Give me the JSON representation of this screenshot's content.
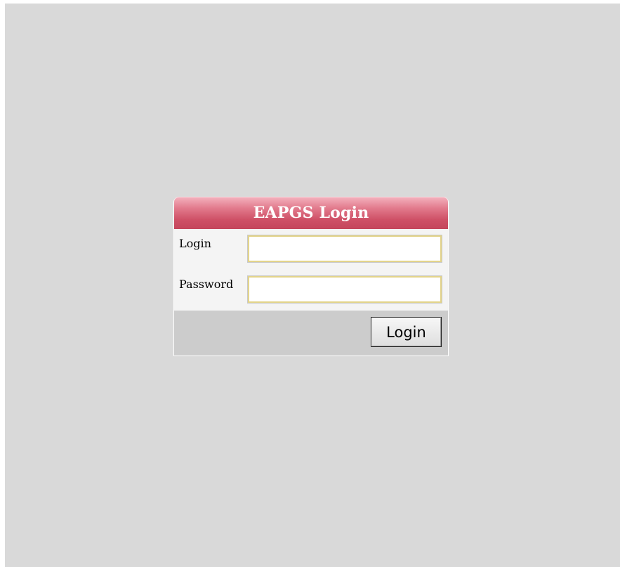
{
  "login_panel": {
    "title": "EAPGS Login",
    "fields": [
      {
        "label": "Login",
        "value": "",
        "placeholder": ""
      },
      {
        "label": "Password",
        "value": "",
        "placeholder": ""
      }
    ],
    "submit_label": "Login"
  },
  "colors": {
    "background": "#d9d9d9",
    "header_accent": "#cf5167",
    "input_border": "#e3d48a",
    "button_row": "#cccccc"
  }
}
